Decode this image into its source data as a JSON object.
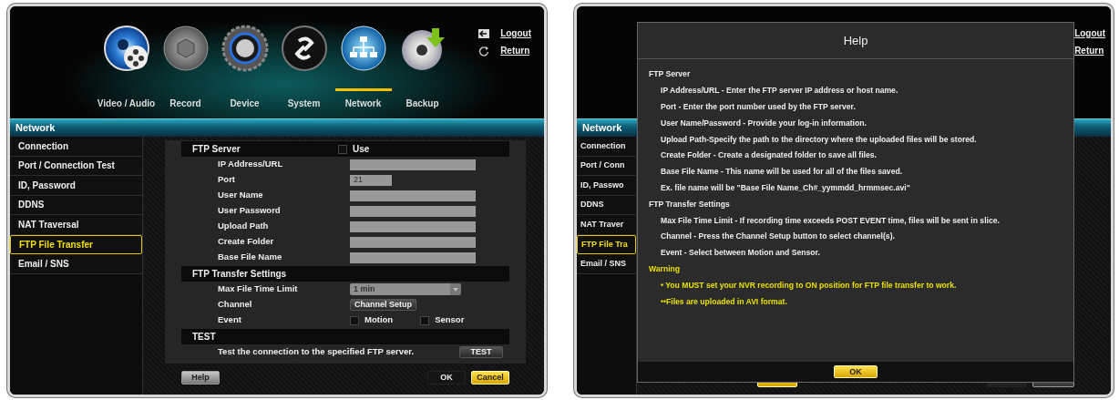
{
  "settings_screen": {
    "top_menu": [
      {
        "label": "Video / Audio",
        "selected": false
      },
      {
        "label": "Record",
        "selected": false
      },
      {
        "label": "Device",
        "selected": false
      },
      {
        "label": "System",
        "selected": false
      },
      {
        "label": "Network",
        "selected": true
      },
      {
        "label": "Backup",
        "selected": false
      }
    ],
    "account_links": [
      {
        "kind": "logout",
        "label": "Logout"
      },
      {
        "kind": "return",
        "label": "Return"
      }
    ],
    "section_title": "Network",
    "sidebar": [
      {
        "label": "Connection",
        "selected": false
      },
      {
        "label": "Port / Connection Test",
        "selected": false
      },
      {
        "label": "ID, Password",
        "selected": false
      },
      {
        "label": "DDNS",
        "selected": false
      },
      {
        "label": "NAT Traversal",
        "selected": false
      },
      {
        "label": "FTP File Transfer",
        "selected": true
      },
      {
        "label": "Email / SNS",
        "selected": false
      }
    ],
    "groups": [
      {
        "title": "FTP Server",
        "checkbox": {
          "label": "Use",
          "checked": false
        },
        "rows": [
          {
            "kind": "text",
            "label": "IP Address/URL"
          },
          {
            "kind": "number",
            "label": "Port",
            "value": "21"
          },
          {
            "kind": "text",
            "label": "User Name"
          },
          {
            "kind": "text",
            "label": "User Password"
          },
          {
            "kind": "text",
            "label": "Upload Path"
          },
          {
            "kind": "text",
            "label": "Create Folder"
          },
          {
            "kind": "text",
            "label": "Base File Name"
          }
        ]
      },
      {
        "title": "FTP Transfer Settings",
        "rows": [
          {
            "kind": "select",
            "label": "Max File Time Limit",
            "value": "1 min"
          },
          {
            "kind": "button",
            "label": "Channel",
            "button": "Channel Setup"
          },
          {
            "kind": "checkboxes",
            "label": "Event",
            "options": [
              {
                "label": "Motion",
                "checked": false
              },
              {
                "label": "Sensor",
                "checked": false
              }
            ]
          }
        ]
      },
      {
        "title": "TEST",
        "rows": [
          {
            "kind": "note",
            "label": "Test the connection to the specified FTP server.",
            "button": "TEST"
          }
        ]
      }
    ],
    "buttons": [
      {
        "kind": "grey",
        "label": "Help"
      },
      {
        "kind": "dark",
        "label": "OK"
      },
      {
        "kind": "yellow",
        "label": "Cancel"
      }
    ]
  },
  "help_screen": {
    "account_links": [
      {
        "label": "Logout"
      },
      {
        "label": "Return"
      }
    ],
    "section_title": "Network",
    "sidebar": [
      {
        "label": "Connection",
        "selected": false
      },
      {
        "label": "Port / Conn",
        "selected": false
      },
      {
        "label": "ID, Passwo",
        "selected": false
      },
      {
        "label": "DDNS",
        "selected": false
      },
      {
        "label": "NAT Traver",
        "selected": false
      },
      {
        "label": "FTP File Tra",
        "selected": true
      },
      {
        "label": "Email / SNS",
        "selected": false
      }
    ],
    "dialog": {
      "title": "Help",
      "lines": [
        {
          "kind": "heading",
          "text": "FTP Server"
        },
        {
          "kind": "item",
          "text": "IP Address/URL - Enter the FTP server IP address or host name."
        },
        {
          "kind": "item",
          "text": "Port - Enter the port number used by the FTP server."
        },
        {
          "kind": "item",
          "text": "User Name/Password - Provide your log-in information."
        },
        {
          "kind": "item",
          "text": "Upload Path-Specify the path to the directory where the uploaded files will be stored."
        },
        {
          "kind": "item",
          "text": "Create Folder - Create a designated folder to save all files."
        },
        {
          "kind": "item",
          "text": "Base File Name - This name will be used for all of the files saved."
        },
        {
          "kind": "item",
          "text": "Ex. file name will be \"Base File Name_Ch#_yymmdd_hrmmsec.avi\""
        },
        {
          "kind": "heading",
          "text": "FTP Transfer Settings"
        },
        {
          "kind": "item",
          "text": "Max File Time Limit - If recording time exceeds POST EVENT time, files will be sent in slice."
        },
        {
          "kind": "item",
          "text": "Channel - Press the Channel Setup button to select channel(s)."
        },
        {
          "kind": "item",
          "text": "Event - Select between Motion and Sensor."
        },
        {
          "kind": "warning_heading",
          "text": "Warning"
        },
        {
          "kind": "warning",
          "text": "• You MUST set your NVR recording to ON position for FTP file transfer to work."
        },
        {
          "kind": "warning",
          "text": "••Files are uploaded in AVI format."
        }
      ],
      "button": "OK"
    }
  }
}
